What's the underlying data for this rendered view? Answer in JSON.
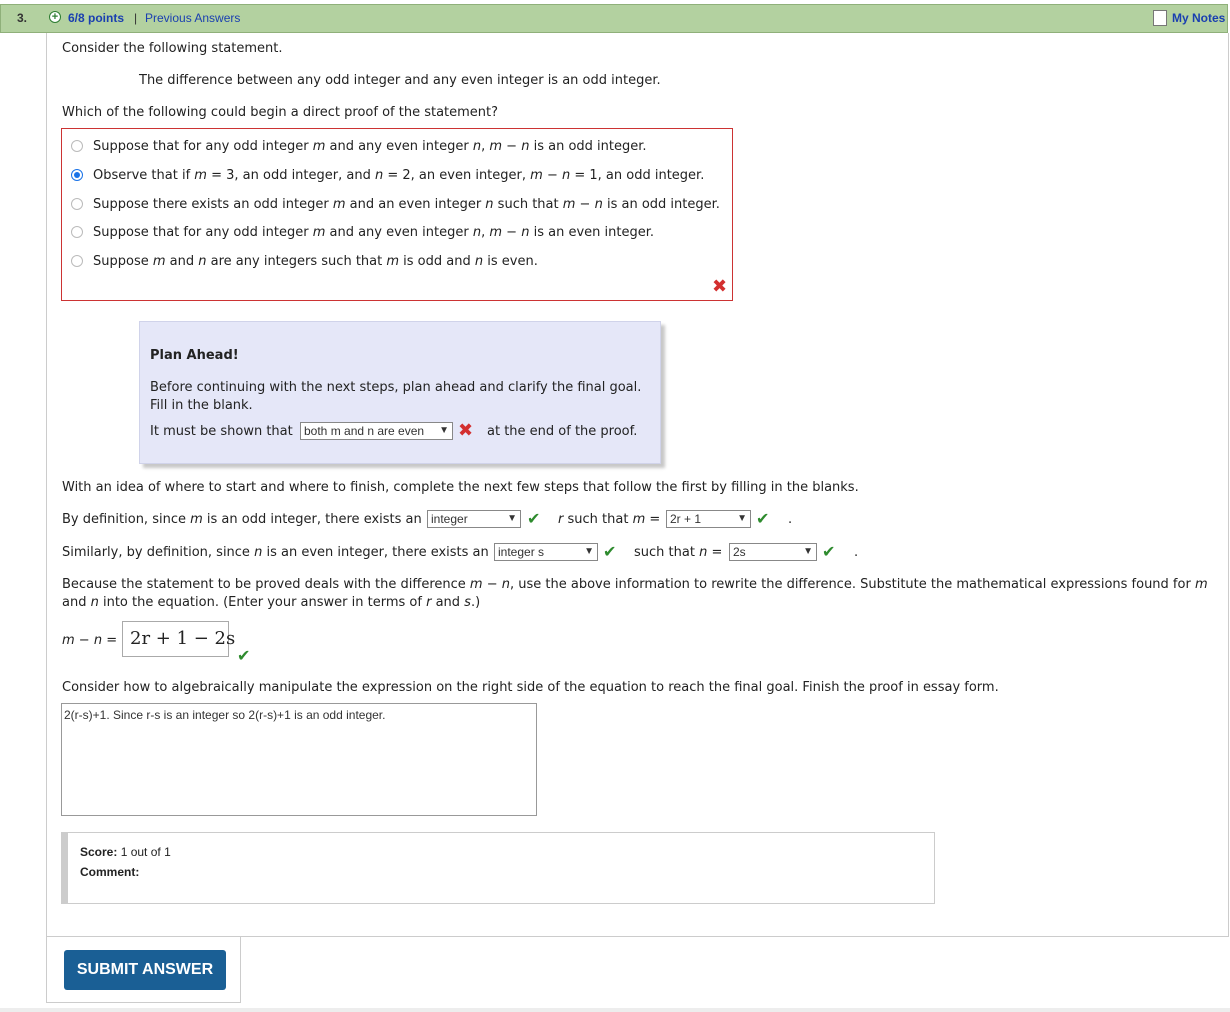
{
  "header": {
    "question_number": "3.",
    "points": "6/8 points",
    "separator": "|",
    "previous_answers": "Previous Answers",
    "my_notes": "My Notes"
  },
  "intro": "Consider the following statement.",
  "statement": "The difference between any odd integer and any even integer is an odd integer.",
  "question": "Which of the following could begin a direct proof of the statement?",
  "options": [
    {
      "p1": "Suppose that for any odd integer ",
      "v1": "m",
      "p2": " and any even integer ",
      "v2": "n",
      "p3": ", ",
      "v3": "m",
      "p4": " − ",
      "v4": "n",
      "p5": " is an odd integer.",
      "selected": false
    },
    {
      "p1": "Observe that if ",
      "v1": "m",
      "p2": " = 3, an odd integer, and ",
      "v2": "n",
      "p3": " = 2, an even integer, ",
      "v3": "m",
      "p4": " − ",
      "v4": "n",
      "p5": " = 1, an odd integer.",
      "selected": true
    },
    {
      "p1": "Suppose there exists an odd integer ",
      "v1": "m",
      "p2": " and an even integer ",
      "v2": "n",
      "p3": " such that ",
      "v3": "m",
      "p4": " − ",
      "v4": "n",
      "p5": " is an odd integer.",
      "selected": false
    },
    {
      "p1": "Suppose that for any odd integer ",
      "v1": "m",
      "p2": " and any even integer ",
      "v2": "n",
      "p3": ", ",
      "v3": "m",
      "p4": " − ",
      "v4": "n",
      "p5": " is an even integer.",
      "selected": false
    },
    {
      "p1": "Suppose ",
      "v1": "m",
      "p2": " and ",
      "v2": "n",
      "p3": " are any integers such that ",
      "v3": "m",
      "p4": " is odd and ",
      "v4": "n",
      "p5": " is even.",
      "selected": false
    }
  ],
  "plan": {
    "title": "Plan Ahead!",
    "line1": "Before continuing with the next steps, plan ahead and clarify the final goal.",
    "line2": "Fill in the blank.",
    "prefix": "It must be shown that",
    "select_value": "both m and n are even",
    "suffix": "at the end of the proof."
  },
  "steps_intro": "With an idea of where to start and where to finish, complete the next few steps that follow the first by filling in the blanks.",
  "step1": {
    "p1": "By definition, since ",
    "v1": "m",
    "p2": " is an odd integer, there exists an",
    "select1": "integer",
    "v2": "r",
    "p3": " such that ",
    "v3": "m",
    "p4": " =",
    "select2": "2r + 1",
    "end": "."
  },
  "step2": {
    "p1": "Similarly, by definition, since ",
    "v1": "n",
    "p2": " is an even integer, there exists an",
    "select1": "integer s",
    "p3": "such that ",
    "v2": "n",
    "p4": " =",
    "select2": "2s",
    "end": "."
  },
  "rewrite": {
    "l1_p1": "Because the statement to be proved deals with the difference ",
    "l1_v1": "m",
    "l1_p2": " − ",
    "l1_v2": "n",
    "l1_p3": ", use the above information to rewrite the difference. Substitute the mathematical expressions found for ",
    "l1_v3": "m",
    "l2_p1": "and ",
    "l2_v1": "n",
    "l2_p2": " into the equation. (Enter your answer in terms of ",
    "l2_v2": "r",
    "l2_p3": " and ",
    "l2_v3": "s",
    "l2_p4": ".)"
  },
  "equation": {
    "lhs_v1": "m",
    "lhs_op": " − ",
    "lhs_v2": "n",
    "lhs_eq": " =",
    "answer": "2r + 1 − 2s"
  },
  "essay_prompt": "Consider how to algebraically manipulate the expression on the right side of the equation to reach the final goal. Finish the proof in essay form.",
  "essay_text": "2(r-s)+1. Since r-s is an integer so 2(r-s)+1 is an odd integer.",
  "score": {
    "label": "Score:",
    "value": "1 out of 1",
    "comment_label": "Comment:"
  },
  "submit_label": "SUBMIT ANSWER",
  "marks": {
    "correct": "✔",
    "incorrect": "✖"
  }
}
